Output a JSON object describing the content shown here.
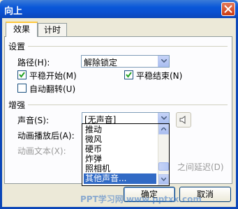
{
  "window": {
    "title": "向上"
  },
  "tabs": [
    {
      "label": "效果"
    },
    {
      "label": "计时"
    }
  ],
  "settings": {
    "section_label": "设置",
    "path_label": "路径(H):",
    "path_value": "解除锁定",
    "smooth_start_label": "平稳开始(M)",
    "smooth_start_checked": true,
    "smooth_end_label": "平稳结束(N)",
    "smooth_end_checked": true,
    "auto_reverse_label": "自动翻转(U)",
    "auto_reverse_checked": false
  },
  "enhance": {
    "section_label": "增强",
    "sound_label": "声音(S):",
    "sound_value": "[无声音]",
    "after_anim_label": "动画播放后(A):",
    "anim_text_label": "动画文本(X):",
    "delay_suffix": "之间延迟(D)"
  },
  "sound_options": {
    "items": [
      "推动",
      "微风",
      "硬币",
      "炸弹",
      "照相机",
      "其他声音..."
    ],
    "selected_index": 5
  },
  "buttons": {
    "ok": "确定",
    "cancel": "取消"
  },
  "watermark": "PPT学习网 www.pptxx.com"
}
